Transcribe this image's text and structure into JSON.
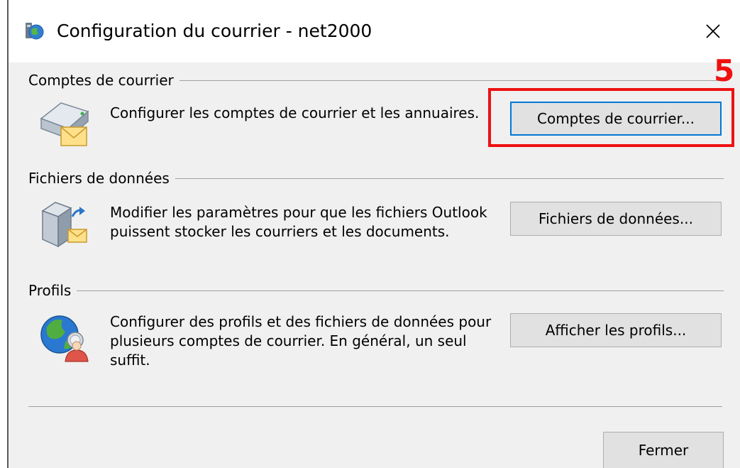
{
  "window": {
    "title": "Configuration du courrier - net2000",
    "close_glyph": "✕"
  },
  "sections": {
    "accounts": {
      "header": "Comptes de courrier",
      "description": "Configurer les comptes de courrier et les annuaires.",
      "button_label": "Comptes de courrier...",
      "icon": "mail-accounts-icon"
    },
    "data_files": {
      "header": "Fichiers de données",
      "description": "Modifier les paramètres pour que les fichiers Outlook puissent stocker les courriers et les documents.",
      "button_label": "Fichiers de données...",
      "icon": "data-files-icon"
    },
    "profiles": {
      "header": "Profils",
      "description": "Configurer des profils et des fichiers de données pour plusieurs comptes de courrier. En général, un seul suffit.",
      "button_label": "Afficher les profils...",
      "icon": "profiles-globe-icon"
    }
  },
  "footer": {
    "close_label": "Fermer"
  },
  "annotation": {
    "step_number": "5",
    "color": "#ee1111"
  },
  "colors": {
    "dialog_background": "#f0f0f0",
    "default_button_border": "#0078d7",
    "button_face": "#e1e1e1"
  }
}
